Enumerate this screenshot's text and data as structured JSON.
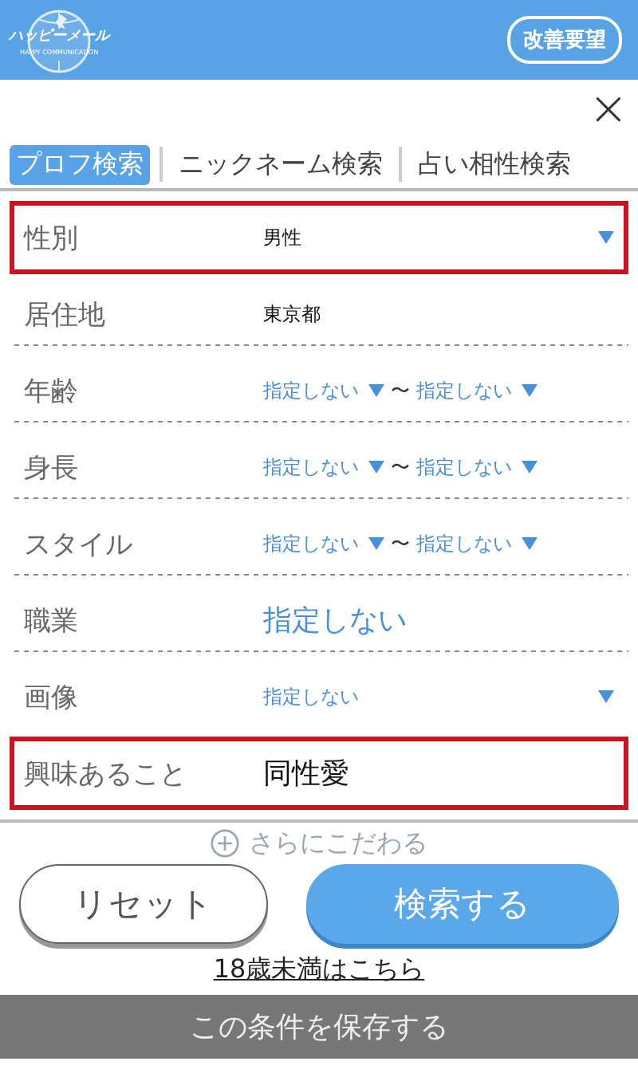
{
  "header": {
    "logo_text": "ハッピーメール",
    "logo_subtext": "HAPPY COMMUNICATION",
    "request_button": "改善要望"
  },
  "close_button": "×",
  "tabs": [
    {
      "label": "プロフ検索",
      "selected": true
    },
    {
      "label": "ニックネーム検索",
      "selected": false
    },
    {
      "label": "占い相性検索",
      "selected": false
    }
  ],
  "rows": [
    {
      "label": "性別",
      "kind": "select",
      "value": "男性",
      "dropdown": true,
      "highlighted": true
    },
    {
      "label": "居住地",
      "kind": "select",
      "value": "東京都",
      "dropdown": false,
      "highlighted": false
    },
    {
      "label": "年齢",
      "kind": "range",
      "from": {
        "placeholder": "指定しない"
      },
      "separator": "〜",
      "to": {
        "placeholder": "指定しない"
      },
      "highlighted": false
    },
    {
      "label": "身長",
      "kind": "range",
      "from": {
        "placeholder": "指定しない"
      },
      "separator": "〜",
      "to": {
        "placeholder": "指定しない"
      },
      "highlighted": false
    },
    {
      "label": "スタイル",
      "kind": "range",
      "from": {
        "placeholder": "指定しない"
      },
      "separator": "〜",
      "to": {
        "placeholder": "指定しない"
      },
      "highlighted": false
    },
    {
      "label": "職業",
      "kind": "link",
      "placeholder": "指定しない",
      "highlighted": false
    },
    {
      "label": "画像",
      "kind": "select",
      "placeholder": "指定しない",
      "dropdown": true,
      "highlighted": false
    },
    {
      "label": "興味あること",
      "kind": "large",
      "value": "同性愛",
      "highlighted": true
    }
  ],
  "more_options": "さらにこだわる",
  "buttons": {
    "reset": "リセット",
    "search": "検索する"
  },
  "under18_link": "18歳未満はこちら",
  "save_bar": "この条件を保存する"
}
